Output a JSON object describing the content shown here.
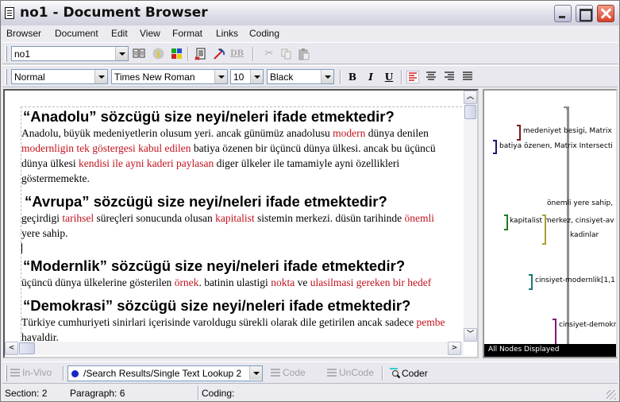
{
  "window": {
    "title": "no1 - Document Browser"
  },
  "menu": [
    "Browser",
    "Document",
    "Edit",
    "View",
    "Format",
    "Links",
    "Coding"
  ],
  "toolbar1": {
    "document_select": "no1",
    "icons": [
      "browse-book-icon",
      "info-icon",
      "node-palette-icon",
      "document-remove-icon",
      "link-icon",
      "db-icon",
      "cut-icon",
      "copy-icon",
      "paste-icon"
    ],
    "db_label": "DB"
  },
  "toolbar2": {
    "style_select": "Normal",
    "font_select": "Times New Roman",
    "size_select": "10",
    "color_select": "Black",
    "bold_label": "B",
    "italic_label": "I",
    "underline_label": "U"
  },
  "document": {
    "sections": [
      {
        "heading": "“Anadolu” sözcügü size neyi/neleri ifade etmektedir?",
        "lines": [
          [
            {
              "t": "Anadolu, büyük medeniyetlerin olusum yeri. ancak günümüz anadolusu "
            },
            {
              "t": "modern",
              "red": true
            },
            {
              "t": " dünya denilen"
            }
          ],
          [
            {
              "t": "modernligin tek göstergesi kabul edilen",
              "red": true
            },
            {
              "t": " batiya özenen bir üçüncü dünya ülkesi. ancak bu üçüncü"
            }
          ],
          [
            {
              "t": "dünya ülkesi "
            },
            {
              "t": "kendisi ile ayni kaderi paylasan",
              "red": true
            },
            {
              "t": " diger ülkeler ile tamamiyle ayni özellikleri"
            }
          ],
          [
            {
              "t": "göstermemekte."
            }
          ]
        ]
      },
      {
        "heading": "“Avrupa” sözcügü size neyi/neleri ifade etmektedir?",
        "lines": [
          [
            {
              "t": "geçirdigi "
            },
            {
              "t": "tarihsel",
              "red": true
            },
            {
              "t": " süreçleri sonucunda olusan "
            },
            {
              "t": "kapitalist",
              "red": true
            },
            {
              "t": " sistemin merkezi. düsün tarihinde "
            },
            {
              "t": "önemli",
              "red": true
            }
          ],
          [
            {
              "t": "yere sahip."
            }
          ]
        ]
      },
      {
        "heading": "“Modernlik” sözcügü size neyi/neleri ifade etmektedir?",
        "lines": [
          [
            {
              "t": "üçüncü dünya ülkelerine gösterilen "
            },
            {
              "t": "örnek",
              "red": true
            },
            {
              "t": ". batinin ulastigi "
            },
            {
              "t": "nokta",
              "red": true
            },
            {
              "t": " ve "
            },
            {
              "t": "ulasilmasi gereken bir hedef",
              "red": true
            }
          ]
        ]
      },
      {
        "heading": "“Demokrasi” sözcügü size neyi/neleri ifade etmektedir?",
        "lines": [
          [
            {
              "t": "Türkiye cumhuriyeti sinirlari içerisinde varoldugu sürekli olarak dile getirilen ancak sadece "
            },
            {
              "t": "pembe",
              "red": true
            }
          ],
          [
            {
              "t": "hayaldir."
            }
          ]
        ]
      }
    ]
  },
  "coding_stripes": {
    "nodes": [
      {
        "label": "medeniyet besigi, Matrix",
        "color": "#7a1b1b"
      },
      {
        "label": "batiya özenen, Matrix Intersecti",
        "color": "#1a1a6e"
      },
      {
        "label": "önemli yere sahip,",
        "color": "#a8a030"
      },
      {
        "label": "kapitalist merkez, cinsiyet-av",
        "color": "#1f7a1f"
      },
      {
        "label": "kadinlar",
        "color": "#808080"
      },
      {
        "label": "cinsiyet-modernlik[1,1",
        "color": "#1a7a7a"
      },
      {
        "label": "cinsiyet-demokr",
        "color": "#7a1a7a"
      }
    ],
    "footer": "All Nodes Displayed"
  },
  "bottom_toolbar": {
    "invivo_label": "In-Vivo",
    "node_path": "/Search Results/Single Text Lookup 2",
    "code_label": "Code",
    "uncode_label": "UnCode",
    "coder_label": "Coder"
  },
  "status": {
    "section": "Section: 2",
    "paragraph": "Paragraph: 6",
    "coding": "Coding:"
  }
}
